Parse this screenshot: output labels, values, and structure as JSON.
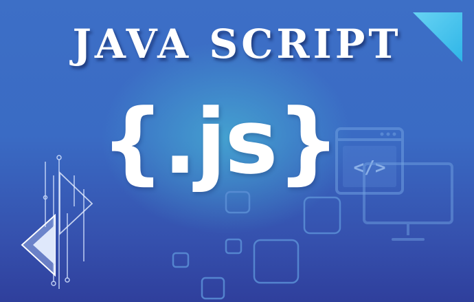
{
  "banner": {
    "title": "JAVA SCRIPT",
    "logo_text": "{.js}",
    "code_tag_text": "</>"
  },
  "colors": {
    "background_top": "#3d6fc6",
    "background_bottom": "#2f3f9c",
    "glow": "#46aad2",
    "accent_cyan": "#35c4ef",
    "text": "#ffffff"
  },
  "icons": [
    "corner-triangle-icon",
    "browser-code-window-icon",
    "monitor-icon",
    "play-arrow-icon"
  ]
}
